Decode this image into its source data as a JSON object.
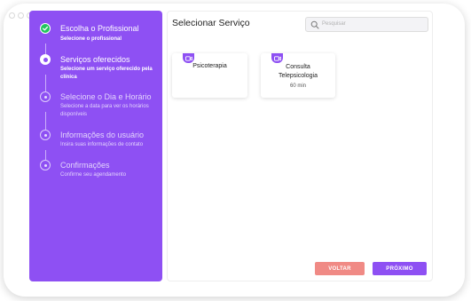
{
  "sidebar": {
    "steps": [
      {
        "title": "Escolha o Profissional",
        "subtitle": "Selecione o profissional",
        "state": "done"
      },
      {
        "title": "Serviços oferecidos",
        "subtitle": "Selecione um serviço oferecido pela clínica",
        "state": "current"
      },
      {
        "title": "Selecione o Dia e Horário",
        "subtitle": "Selecione a data para ver os horários disponíveis",
        "state": "pending"
      },
      {
        "title": "Informações do usuário",
        "subtitle": "Insira suas informações de contato",
        "state": "pending"
      },
      {
        "title": "Confirmações",
        "subtitle": "Confirme seu agendamento",
        "state": "pending"
      }
    ]
  },
  "main": {
    "title": "Selecionar Serviço",
    "search": {
      "placeholder": "Pesquisar"
    },
    "services": [
      {
        "name": "Psicoterapia",
        "duration": "",
        "icon": "video-camera-icon"
      },
      {
        "name": "Consulta Telepsicologia",
        "duration": "60 min",
        "icon": "video-camera-icon"
      }
    ]
  },
  "buttons": {
    "back": "VOLTAR",
    "next": "PRÓXIMO"
  },
  "colors": {
    "accent": "#8e50f3",
    "back": "#f08a85",
    "done": "#22c55e"
  }
}
